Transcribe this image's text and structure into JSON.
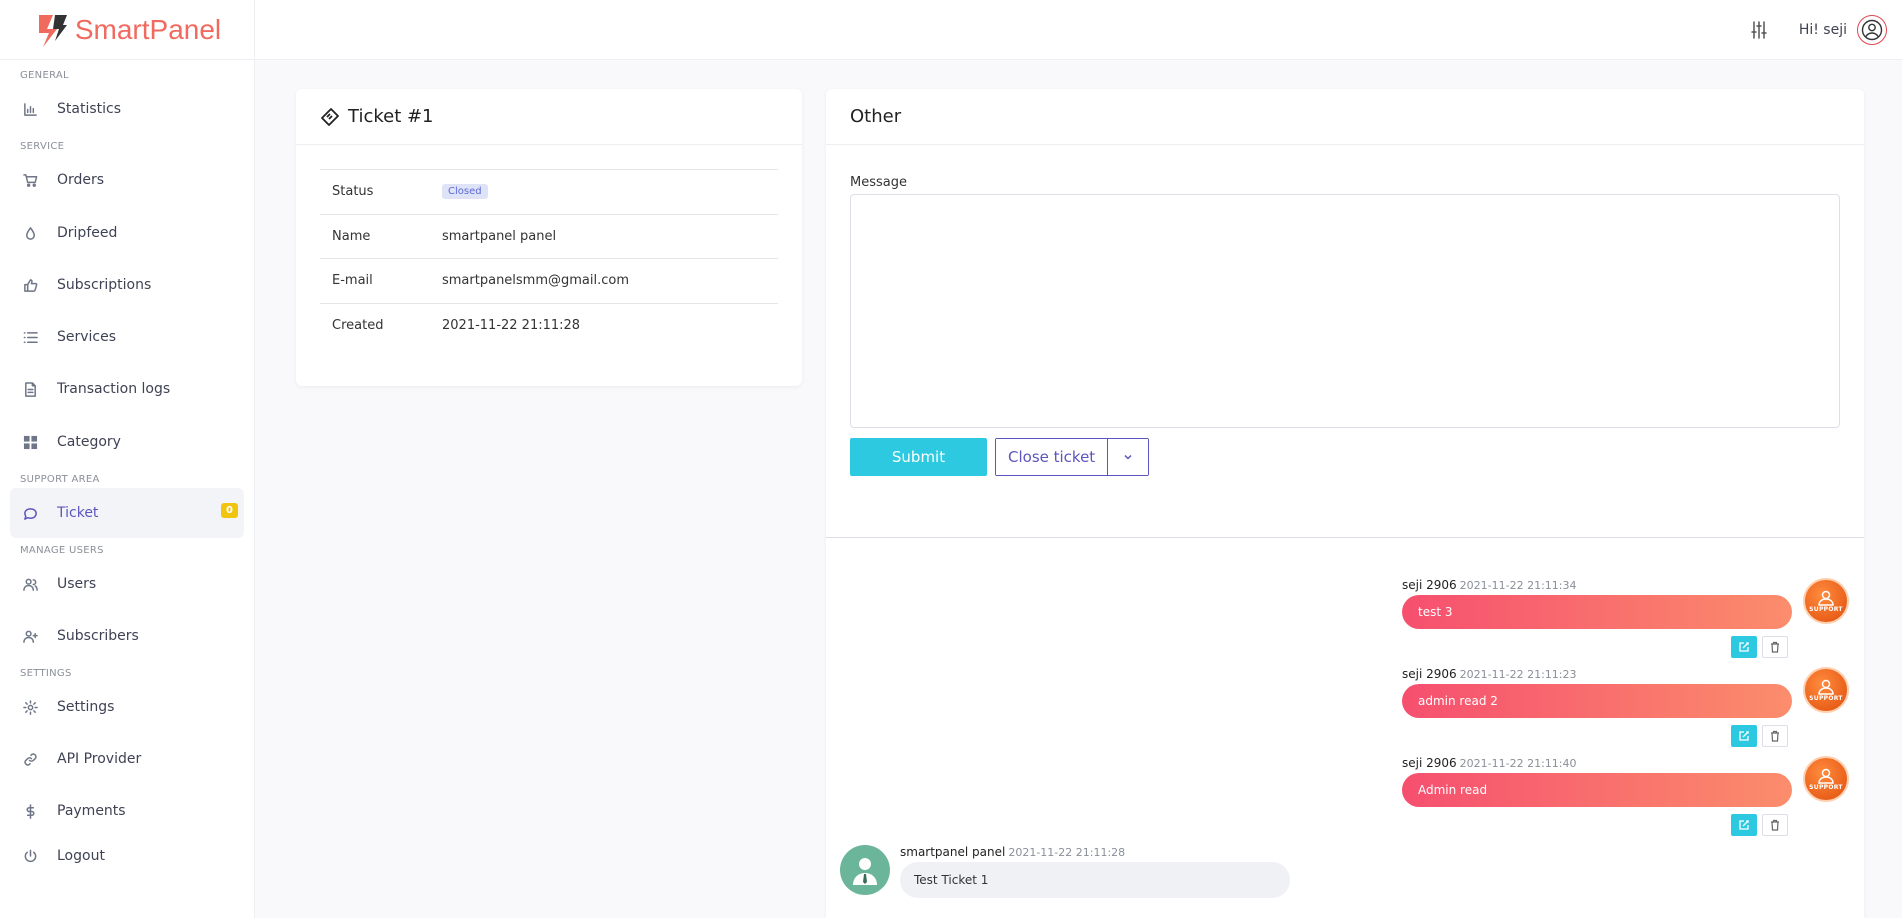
{
  "brand": {
    "name": "SmartPanel"
  },
  "header": {
    "greeting": "Hi! seji"
  },
  "sidebar": {
    "sections": {
      "general": "GENERAL",
      "service": "SERVICE",
      "support": "SUPPORT AREA",
      "manage": "MANAGE USERS",
      "settings": "SETTINGS"
    },
    "items": {
      "statistics": "Statistics",
      "orders": "Orders",
      "dripfeed": "Dripfeed",
      "subscriptions": "Subscriptions",
      "services": "Services",
      "transaction_logs": "Transaction logs",
      "category": "Category",
      "ticket": "Ticket",
      "ticket_badge": "0",
      "users": "Users",
      "subscribers": "Subscribers",
      "settings": "Settings",
      "api_provider": "API Provider",
      "payments": "Payments",
      "logout": "Logout"
    }
  },
  "ticket_card": {
    "title": "Ticket #1",
    "rows": [
      {
        "label": "Status",
        "value": "Closed"
      },
      {
        "label": "Name",
        "value": "smartpanel panel"
      },
      {
        "label": "E-mail",
        "value": "smartpanelsmm@gmail.com"
      },
      {
        "label": "Created",
        "value": "2021-11-22 21:11:28"
      }
    ]
  },
  "other_card": {
    "title": "Other",
    "message_label": "Message",
    "submit_label": "Submit",
    "close_ticket_label": "Close ticket"
  },
  "messages": [
    {
      "author": "seji 2906",
      "time": "2021-11-22 21:11:34",
      "text": "test 3"
    },
    {
      "author": "seji 2906",
      "time": "2021-11-22 21:11:23",
      "text": "admin read 2"
    },
    {
      "author": "seji 2906",
      "time": "2021-11-22 21:11:40",
      "text": "Admin read"
    },
    {
      "author": "smartpanel panel",
      "time": "2021-11-22 21:11:28",
      "text": "Test Ticket 1"
    }
  ],
  "support_avatar_text": "SUPPORT",
  "colors": {
    "accent": "#5c55bf",
    "primary_button": "#2dc9e0",
    "brand": "#f06a5f",
    "badge": "#f1c40f"
  }
}
